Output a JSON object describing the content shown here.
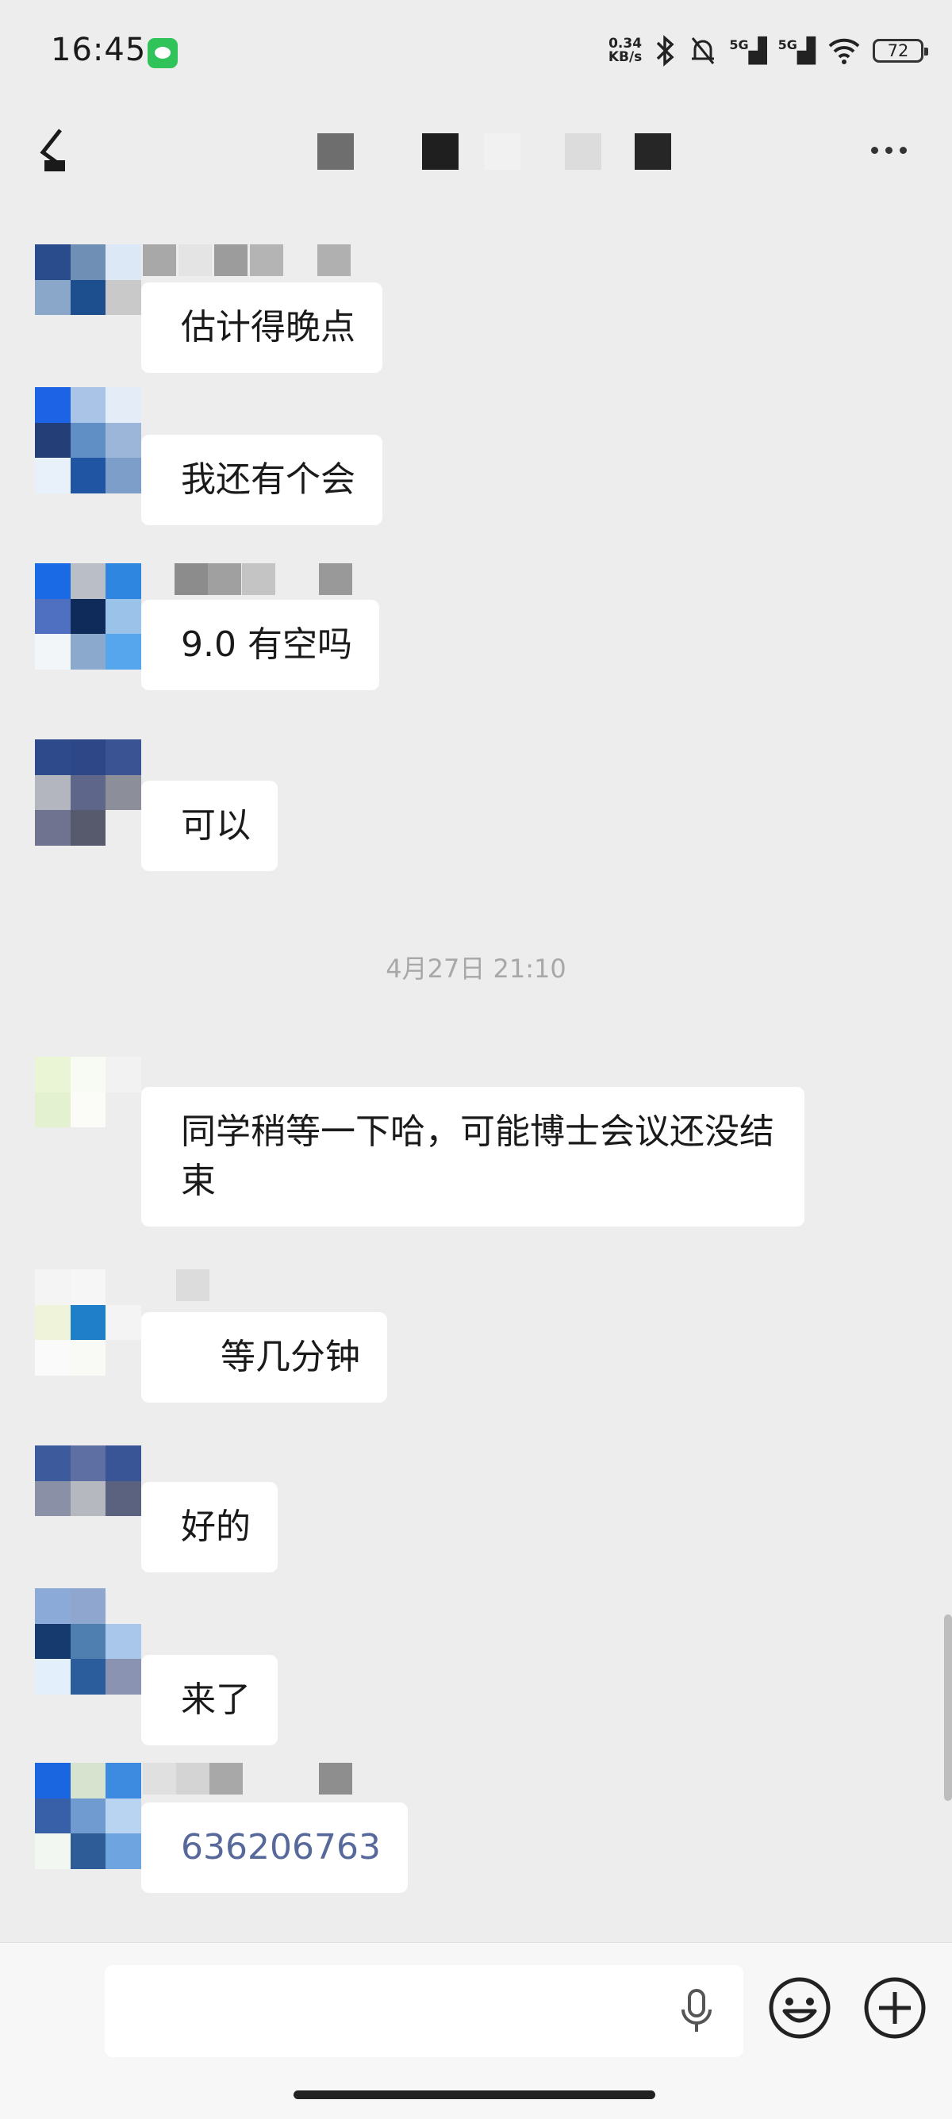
{
  "status_bar": {
    "time": "16:45",
    "net_speed_value": "0.34",
    "net_speed_unit": "KB/s",
    "signal1": "5G",
    "signal2": "5G",
    "battery": "72"
  },
  "header": {
    "title": "",
    "back_icon": "back-arrow-icon",
    "more_icon": "more-dots-icon"
  },
  "messages": [
    {
      "text": "估计得晚点"
    },
    {
      "text": "我还有个会"
    },
    {
      "text": "9.0 有空吗"
    },
    {
      "text": "可以"
    },
    {
      "timestamp": "4月27日 21:10"
    },
    {
      "text": "同学稍等一下哈，可能博士会议还没结束"
    },
    {
      "text": "等几分钟"
    },
    {
      "text": "好的"
    },
    {
      "text": "来了"
    },
    {
      "text": "636206763"
    }
  ],
  "input_bar": {
    "mic_icon": "microphone-icon",
    "emoji_icon": "emoji-icon",
    "plus_icon": "plus-icon"
  },
  "colors": {
    "background": "#ededed",
    "bubble": "#ffffff",
    "link_text": "#57689a",
    "timestamp": "#a8a8a8"
  }
}
